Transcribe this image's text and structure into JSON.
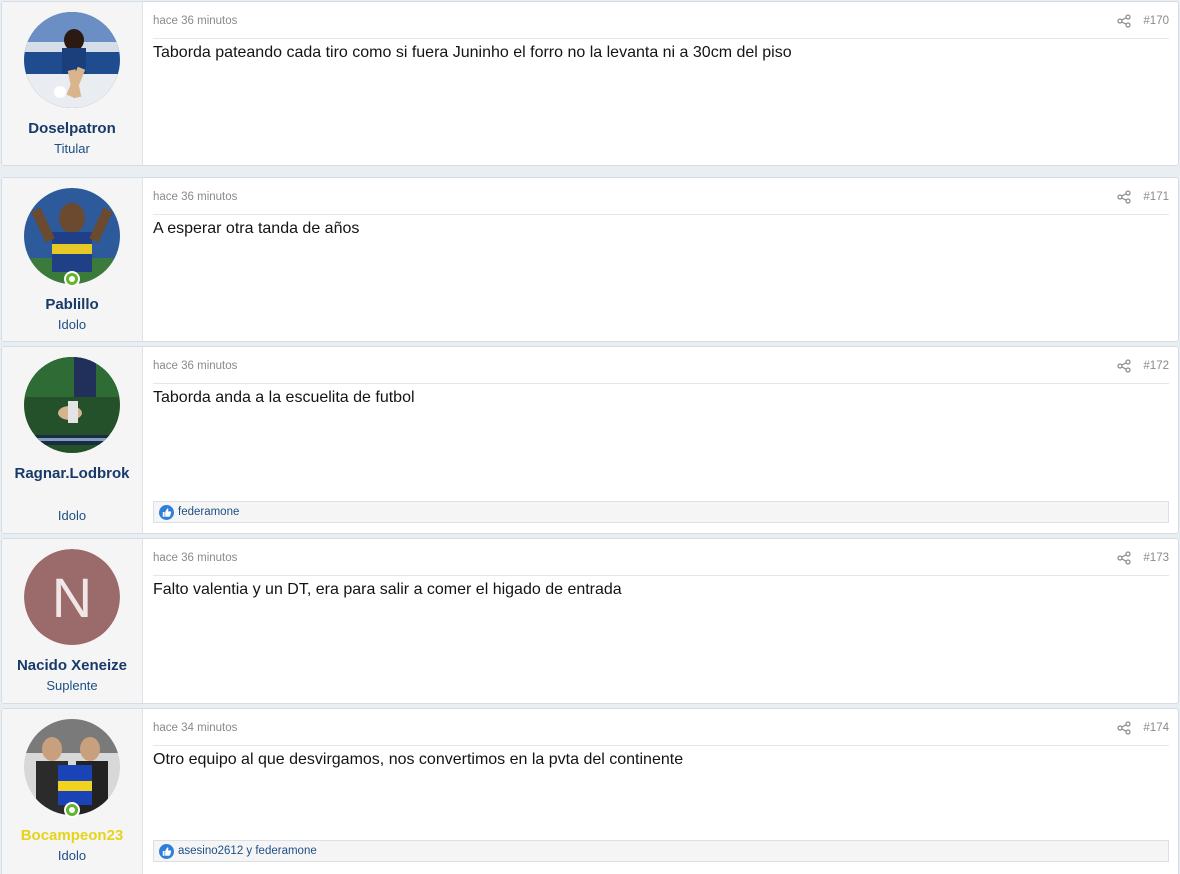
{
  "posts": [
    {
      "username": "Doselpatron",
      "usertitle": "Titular",
      "time": "hace 36 minutos",
      "number": "#170",
      "body": "Taborda pateando cada tiro como si fuera Juninho el forro no la levanta ni a 30cm del piso",
      "online": false,
      "avatar_icon": "player-photo"
    },
    {
      "username": "Pablillo",
      "usertitle": "Idolo",
      "time": "hace 36 minutos",
      "number": "#171",
      "body": "A esperar otra tanda de años",
      "online": true,
      "avatar_icon": "player-photo"
    },
    {
      "username": "Ragnar.Lodbrok",
      "usertitle": "Idolo",
      "time": "hace 36 minutos",
      "number": "#172",
      "body": "Taborda anda a la escuelita de futbol",
      "online": false,
      "reactions": "federamone",
      "avatar_icon": "player-photo"
    },
    {
      "username": "Nacido Xeneize",
      "usertitle": "Suplente",
      "time": "hace 36 minutos",
      "number": "#173",
      "body": "Falto valentia y un DT, era para salir a comer el higado de entrada",
      "online": false,
      "avatar_letter": "N"
    },
    {
      "username": "Bocampeon23",
      "usertitle": "Idolo",
      "time": "hace 34 minutos",
      "number": "#174",
      "body": "Otro equipo al que desvirgamos, nos convertimos en la pvta del continente",
      "online": true,
      "reactions": "asesino2612 y federamone",
      "avatar_icon": "fans-photo"
    }
  ],
  "colors": {
    "username": "#183a6a",
    "username_highlight": "#e6d31a",
    "online": "#63b32c",
    "like": "#2e7fd8"
  }
}
